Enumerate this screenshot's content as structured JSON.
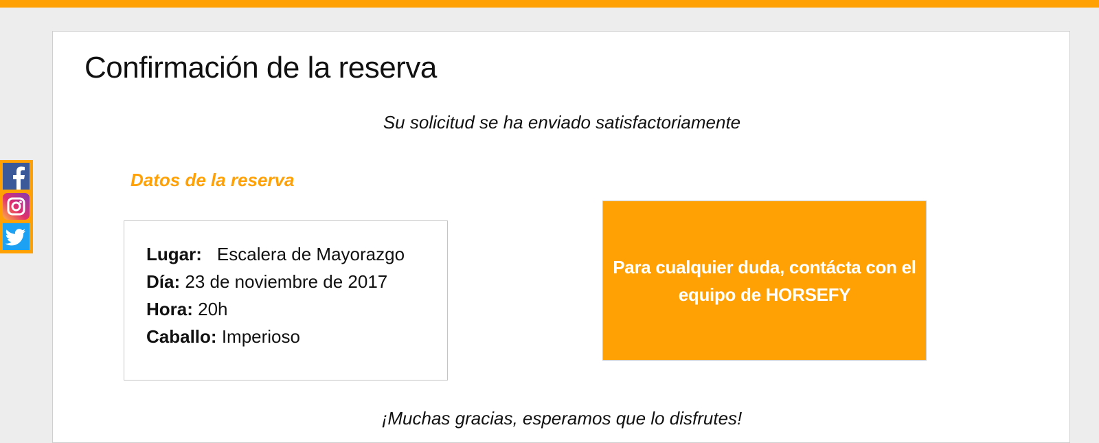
{
  "colors": {
    "accent": "#ffa005",
    "background": "#ededed",
    "card": "#ffffff",
    "facebook": "#3b5998",
    "twitter": "#1da1f2"
  },
  "social": [
    {
      "name": "facebook",
      "icon": "facebook-icon"
    },
    {
      "name": "instagram",
      "icon": "instagram-icon"
    },
    {
      "name": "twitter",
      "icon": "twitter-icon"
    }
  ],
  "page": {
    "title": "Confirmación de la reserva",
    "subtitle": "Su solicitud se ha enviado satisfactoriamente",
    "thanks": "¡Muchas gracias, esperamos que lo disfrutes!"
  },
  "booking": {
    "heading": "Datos de la reserva",
    "rows": [
      {
        "label": "Lugar:",
        "value": "Escalera de Mayorazgo"
      },
      {
        "label": "Día:",
        "value": "23 de noviembre de 2017"
      },
      {
        "label": "Hora:",
        "value": "20h"
      },
      {
        "label": "Caballo:",
        "value": "Imperioso"
      }
    ]
  },
  "contact": {
    "text": "Para cualquier duda, contácta con el equipo de HORSEFY"
  }
}
